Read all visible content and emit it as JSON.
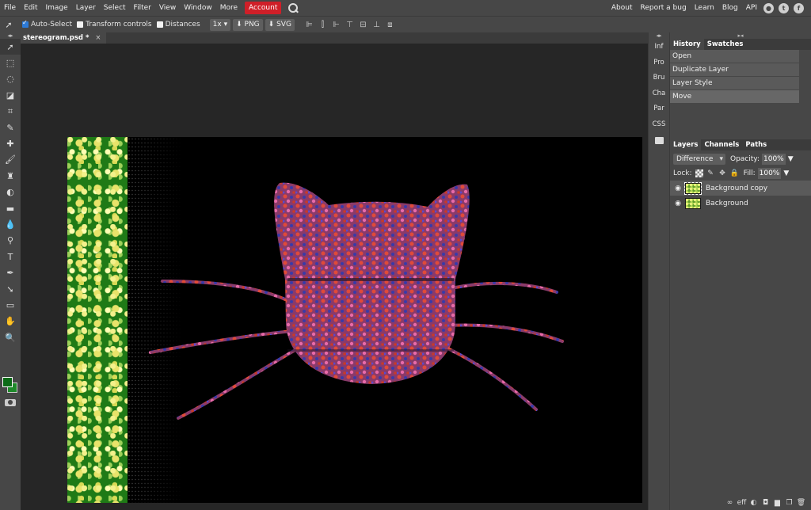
{
  "menu": {
    "items": [
      "File",
      "Edit",
      "Image",
      "Layer",
      "Select",
      "Filter",
      "View",
      "Window",
      "More"
    ],
    "account": "Account",
    "right_links": [
      "About",
      "Report a bug",
      "Learn",
      "Blog",
      "API"
    ]
  },
  "options_bar": {
    "auto_select": "Auto-Select",
    "transform_controls": "Transform controls",
    "distances": "Distances",
    "scale": "1x",
    "png": "PNG",
    "svg": "SVG"
  },
  "document": {
    "tab_title": "stereogram.psd *",
    "close": "×"
  },
  "mini_panel": [
    "Inf",
    "Pro",
    "Bru",
    "Cha",
    "Par",
    "CSS"
  ],
  "history": {
    "tabs": [
      "History",
      "Swatches"
    ],
    "items": [
      "Open",
      "Duplicate Layer",
      "Layer Style",
      "Move"
    ]
  },
  "layers": {
    "tabs": [
      "Layers",
      "Channels",
      "Paths"
    ],
    "blend_mode": "Difference",
    "opacity_label": "Opacity:",
    "opacity_value": "100%",
    "lock_label": "Lock:",
    "fill_label": "Fill:",
    "fill_value": "100%",
    "items": [
      "Background copy",
      "Background"
    ],
    "footer_off": "eff"
  },
  "colors": {
    "accent_red": "#cf1f28",
    "foreground": "#0c6b17",
    "background": "#1e8a2a"
  }
}
